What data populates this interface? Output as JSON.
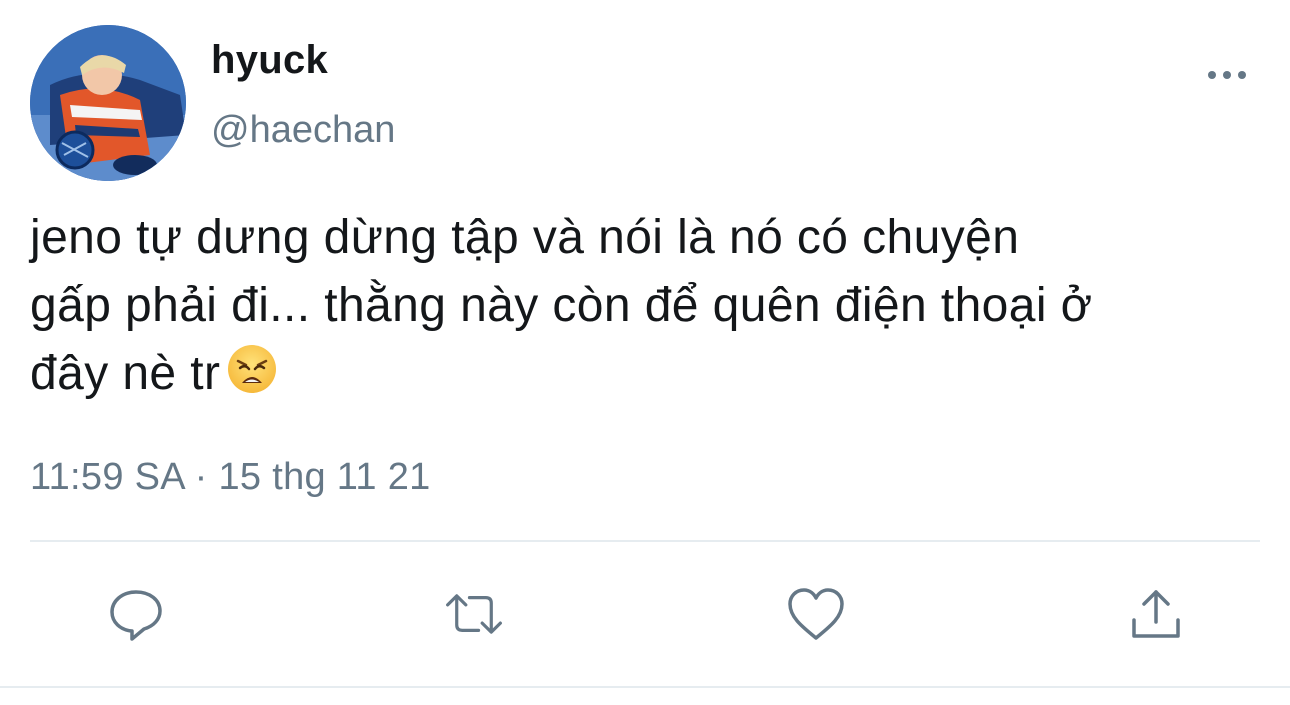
{
  "tweet": {
    "author": {
      "display_name": "hyuck",
      "handle": "@haechan"
    },
    "text_lines": [
      "jeno tự dưng dừng tập và nói là nó có chuyện",
      "gấp phải đi... thằng này còn để quên điện thoại ở",
      "đây nè tr"
    ],
    "emoji": "weary-face",
    "timestamp": "11:59 SA · 15 thg 11 21"
  },
  "actions": [
    {
      "name": "reply",
      "icon": "speech-bubble-icon"
    },
    {
      "name": "retweet",
      "icon": "retweet-icon"
    },
    {
      "name": "like",
      "icon": "heart-icon"
    },
    {
      "name": "share",
      "icon": "share-icon"
    }
  ],
  "colors": {
    "text": "#14171a",
    "secondary": "#657786",
    "icon": "#657786",
    "divider": "#e6ecf0"
  }
}
